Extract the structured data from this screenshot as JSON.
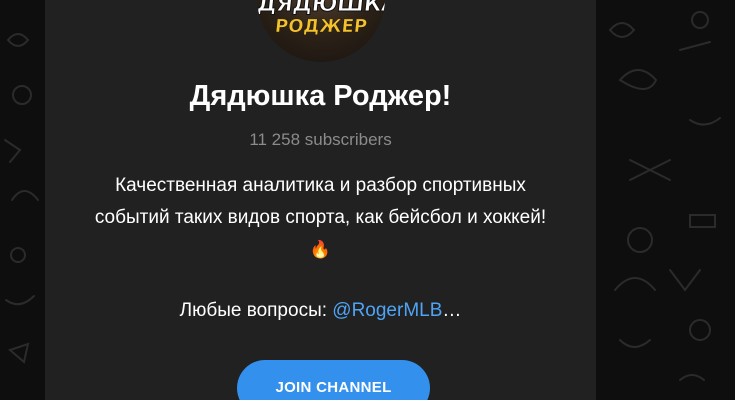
{
  "channel": {
    "avatar_text_line1": "ДЯДЮШКА",
    "avatar_text_line2": "РОДЖЕР",
    "name": "Дядюшка Роджер!",
    "subscribers": "11 258 subscribers",
    "description": "Качественная аналитика и разбор спортивных событий таких видов спорта, как бейсбол и хоккей!",
    "description_emoji": "🔥",
    "contact_label": "Любые вопросы: ",
    "contact_link": "@RogerMLB",
    "contact_ellipsis": "…"
  },
  "actions": {
    "join_label": "JOIN CHANNEL"
  },
  "colors": {
    "card_bg": "#212121",
    "page_bg": "#0e0e0e",
    "accent": "#3390ec",
    "link": "#4ea4f6",
    "muted_text": "#8b8b8b"
  }
}
